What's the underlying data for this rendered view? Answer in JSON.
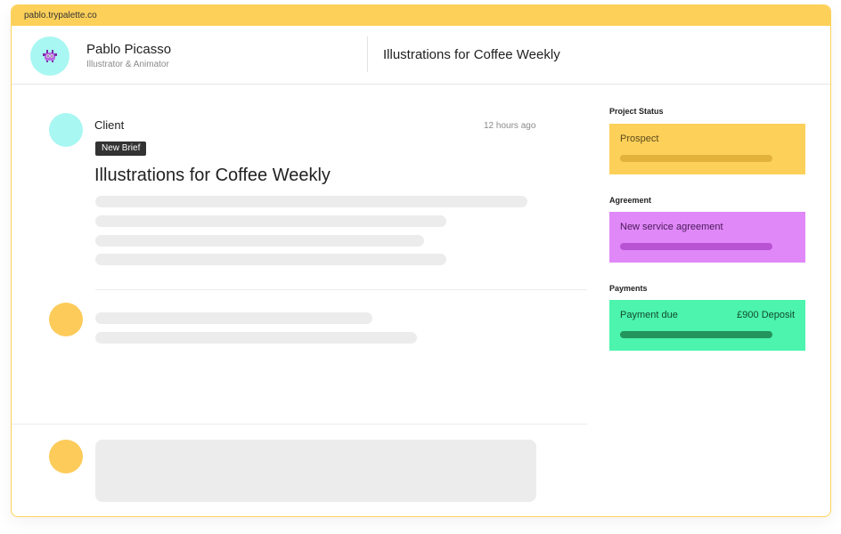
{
  "browser": {
    "url": "pablo.trypalette.co"
  },
  "profile": {
    "name": "Pablo Picasso",
    "role": "Illustrator & Animator"
  },
  "header": {
    "title": "Illustrations for Coffee Weekly"
  },
  "brief": {
    "author": "Client",
    "timestamp": "12 hours ago",
    "badge": "New Brief",
    "title": "Illustrations for Coffee Weekly"
  },
  "sidebar": {
    "project_status": {
      "label": "Project Status",
      "value": "Prospect",
      "color": "#fdd05a",
      "bar_color": "#e2b23a"
    },
    "agreement": {
      "label": "Agreement",
      "value": "New service agreement",
      "color": "#e088f8",
      "bar_color": "#b853d3"
    },
    "payments": {
      "label": "Payments",
      "value": "Payment due",
      "amount": "£900 Deposit",
      "color": "#4cf4ad",
      "bar_color": "#22945c"
    }
  },
  "colors": {
    "accent_yellow": "#fdd05a",
    "avatar_cyan": "#a9f7f2",
    "avatar_orange": "#fdcb5a",
    "skeleton": "#ececec"
  },
  "icons": {
    "avatar": "monster-icon"
  }
}
